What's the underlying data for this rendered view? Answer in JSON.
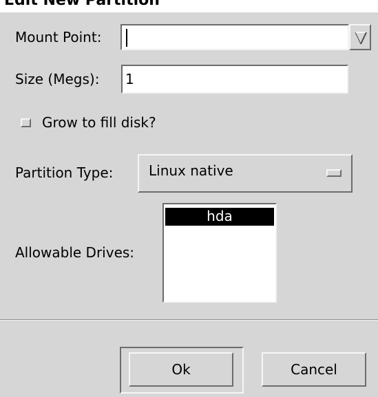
{
  "dialog": {
    "title": "Edit New Partition"
  },
  "mount_point": {
    "label": "Mount Point:",
    "value": "",
    "combo_icon": "triangle-down-icon"
  },
  "size": {
    "label": "Size (Megs):",
    "value": "1"
  },
  "grow": {
    "label": "Grow to fill disk?",
    "checked": false
  },
  "partition_type": {
    "label": "Partition Type:",
    "selected": "Linux native"
  },
  "drives": {
    "label": "Allowable Drives:",
    "items": [
      "hda"
    ],
    "selected_index": 0
  },
  "buttons": {
    "ok": "Ok",
    "cancel": "Cancel"
  }
}
